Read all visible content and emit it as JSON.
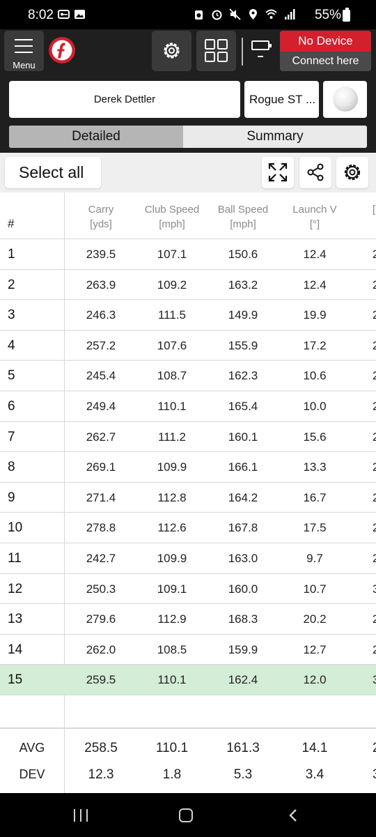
{
  "status_bar": {
    "time": "8:02",
    "battery": "55%",
    "left_icons": [
      "auth-key-icon",
      "image-icon"
    ],
    "right_icons": [
      "recycle-icon",
      "alarm-icon",
      "mute-icon",
      "location-icon",
      "wifi-icon",
      "signal-icon"
    ]
  },
  "header": {
    "menu_label": "Menu",
    "logo": "flightscope-logo",
    "device_status": "No Device",
    "connect_label": "Connect here",
    "device_battery_level": "–"
  },
  "session": {
    "player_name": "Derek Dettler",
    "club_name": "Rogue ST ...",
    "ball_icon": "golf-ball-icon"
  },
  "view_tabs": [
    {
      "label": "Detailed",
      "active": true
    },
    {
      "label": "Summary",
      "active": false
    }
  ],
  "toolbar": {
    "select_all_label": "Select all",
    "icons": [
      "expand-icon",
      "share-icon",
      "settings-icon"
    ]
  },
  "table": {
    "number_header": "#",
    "columns": [
      {
        "name": "Carry",
        "unit": "[yds]"
      },
      {
        "name": "Club Speed",
        "unit": "[mph]"
      },
      {
        "name": "Ball Speed",
        "unit": "[mph]"
      },
      {
        "name": "Launch V",
        "unit": "[°]"
      },
      {
        "name": "",
        "unit": "["
      }
    ],
    "rows": [
      {
        "n": "1",
        "carry": "239.5",
        "club_speed": "107.1",
        "ball_speed": "150.6",
        "launch_v": "12.4",
        "edge": "2"
      },
      {
        "n": "2",
        "carry": "263.9",
        "club_speed": "109.2",
        "ball_speed": "163.2",
        "launch_v": "12.4",
        "edge": "2"
      },
      {
        "n": "3",
        "carry": "246.3",
        "club_speed": "111.5",
        "ball_speed": "149.9",
        "launch_v": "19.9",
        "edge": "2"
      },
      {
        "n": "4",
        "carry": "257.2",
        "club_speed": "107.6",
        "ball_speed": "155.9",
        "launch_v": "17.2",
        "edge": "2"
      },
      {
        "n": "5",
        "carry": "245.4",
        "club_speed": "108.7",
        "ball_speed": "162.3",
        "launch_v": "10.6",
        "edge": "2"
      },
      {
        "n": "6",
        "carry": "249.4",
        "club_speed": "110.1",
        "ball_speed": "165.4",
        "launch_v": "10.0",
        "edge": "2"
      },
      {
        "n": "7",
        "carry": "262.7",
        "club_speed": "111.2",
        "ball_speed": "160.1",
        "launch_v": "15.6",
        "edge": "2"
      },
      {
        "n": "8",
        "carry": "269.1",
        "club_speed": "109.9",
        "ball_speed": "166.1",
        "launch_v": "13.3",
        "edge": "2"
      },
      {
        "n": "9",
        "carry": "271.4",
        "club_speed": "112.8",
        "ball_speed": "164.2",
        "launch_v": "16.7",
        "edge": "2"
      },
      {
        "n": "10",
        "carry": "278.8",
        "club_speed": "112.6",
        "ball_speed": "167.8",
        "launch_v": "17.5",
        "edge": "2"
      },
      {
        "n": "11",
        "carry": "242.7",
        "club_speed": "109.9",
        "ball_speed": "163.0",
        "launch_v": "9.7",
        "edge": "2"
      },
      {
        "n": "12",
        "carry": "250.3",
        "club_speed": "109.1",
        "ball_speed": "160.0",
        "launch_v": "10.7",
        "edge": "3"
      },
      {
        "n": "13",
        "carry": "279.6",
        "club_speed": "112.9",
        "ball_speed": "168.3",
        "launch_v": "20.2",
        "edge": "2"
      },
      {
        "n": "14",
        "carry": "262.0",
        "club_speed": "108.5",
        "ball_speed": "159.9",
        "launch_v": "12.7",
        "edge": "2"
      },
      {
        "n": "15",
        "carry": "259.5",
        "club_speed": "110.1",
        "ball_speed": "162.4",
        "launch_v": "12.0",
        "edge": "3",
        "selected": true
      }
    ],
    "avg": {
      "label": "AVG",
      "carry": "258.5",
      "club_speed": "110.1",
      "ball_speed": "161.3",
      "launch_v": "14.1",
      "edge": "2"
    },
    "dev": {
      "label": "DEV",
      "carry": "12.3",
      "club_speed": "1.8",
      "ball_speed": "5.3",
      "launch_v": "3.4",
      "edge": "3"
    }
  },
  "colors": {
    "accent_red": "#d41f2d",
    "selected_row": "#d4edd6",
    "header_bg": "#1f1f1f"
  }
}
